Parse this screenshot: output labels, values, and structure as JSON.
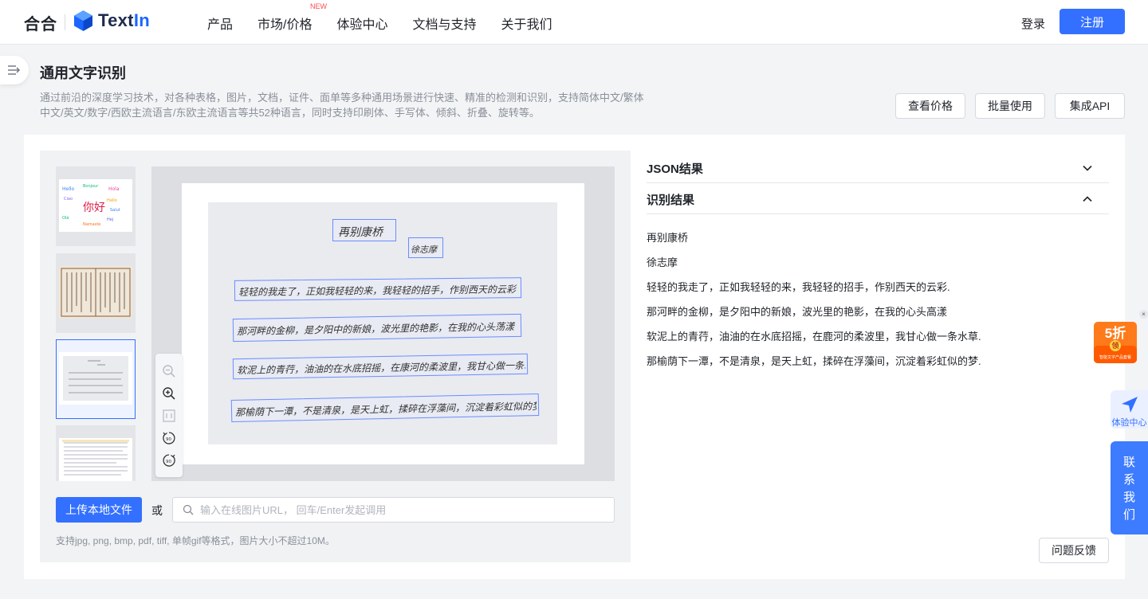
{
  "header": {
    "hehe_logo": "合合",
    "brand": {
      "text_part": "Text",
      "accent_part": "In"
    },
    "nav": [
      {
        "label": "产品",
        "tag": ""
      },
      {
        "label": "市场/价格",
        "tag": "NEW"
      },
      {
        "label": "体验中心",
        "tag": ""
      },
      {
        "label": "文档与支持",
        "tag": ""
      },
      {
        "label": "关于我们",
        "tag": ""
      }
    ],
    "login": "登录",
    "register": "注册"
  },
  "page": {
    "title": "通用文字识别",
    "description": "通过前沿的深度学习技术，对各种表格，图片，文档，证件、面单等多种通用场景进行快速、精准的检测和识别，支持简体中文/繁体中文/英文/数字/西欧主流语言/东欧主流语言等共52种语言，同时支持印刷体、手写体、倾斜、折叠、旋转等。",
    "buttons": {
      "price": "查看价格",
      "batch": "批量使用",
      "api": "集成API"
    }
  },
  "thumbnails": [
    {
      "name": "word-cloud",
      "active": false,
      "text": "你好"
    },
    {
      "name": "ancient-document",
      "active": false
    },
    {
      "name": "handwriting-sample",
      "active": true
    },
    {
      "name": "printed-document",
      "active": false
    }
  ],
  "handwriting_preview": [
    "再别康桥",
    "徐志摩",
    "轻轻的我走了，正如我轻轻的来，我轻轻的招手，作别西天的云彩",
    "那河畔的金柳，是夕阳中的新娘，波光里的艳影，在我的心头荡漾",
    "软泥上的青荇，油油的在水底招摇，在康河的柔波里，我甘心做一条水草",
    "那榆荫下一潭，不是清泉，是天上虹，揉碎在浮藻间，沉淀着彩虹似的梦"
  ],
  "zoom_tools": [
    "zoom-out-icon",
    "zoom-in-icon",
    "fit-icon",
    "rotate-left-90-icon",
    "rotate-right-90-icon"
  ],
  "upload": {
    "button": "上传本地文件",
    "or": "或",
    "url_placeholder": "输入在线图片URL， 回车/Enter发起调用",
    "hint": "支持jpg, png, bmp, pdf, tiff, 单帧gif等格式，图片大小不超过10M。"
  },
  "results": {
    "json_title": "JSON结果",
    "ocr_title": "识别结果",
    "lines": [
      "再别康桥",
      "徐志摩",
      "轻轻的我走了，正如我轻轻的来，我轻轻的招手，作别西天的云彩.",
      "那河畔的金柳，是夕阳中的新娘，波光里的艳影，在我的心头高漾",
      "软泥上的青荇，油油的在水底招摇，在鹿河的柔波里，我甘心做一条水草.",
      "那榆荫下一潭，不是清泉，是天上虹，揉碎在浮藻间，沉淀着彩虹似的梦."
    ],
    "feedback": "问题反馈"
  },
  "floating": {
    "promo": "5折",
    "promo_badge": "领",
    "promo_small": "智能文字产品套餐",
    "close": "×",
    "experience": "体验中心",
    "contact": "联系我们"
  },
  "colors": {
    "primary": "#3370ff",
    "bbox": "#6b8cff",
    "promo": "#ff7a1a"
  }
}
